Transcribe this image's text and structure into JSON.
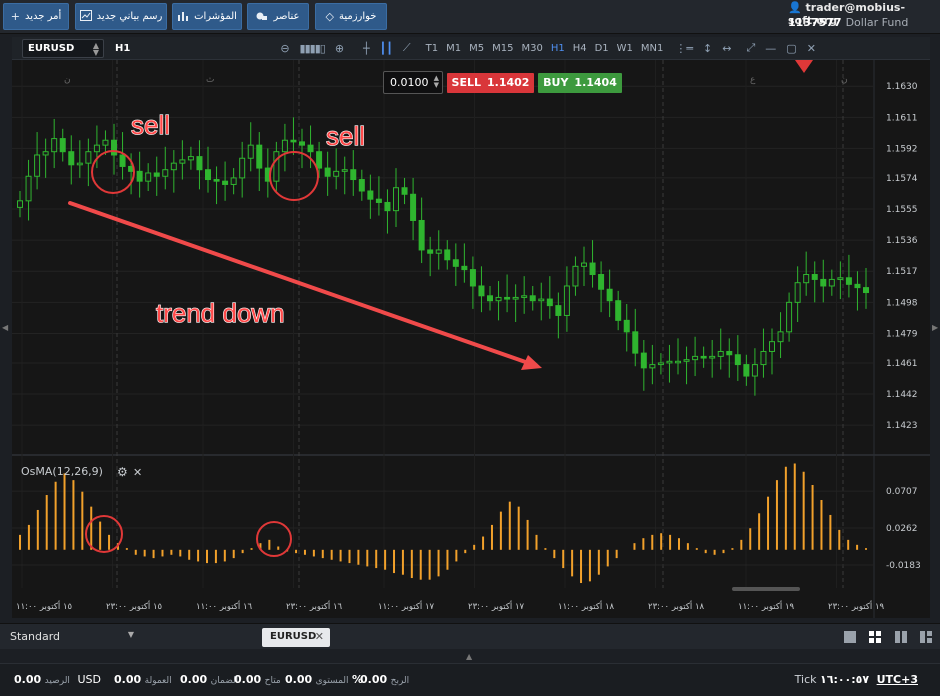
{
  "topbar": {
    "buttons": [
      {
        "label": "أمر جديد",
        "icon": "+"
      },
      {
        "label": "رسم بياني جديد",
        "icon": "chart-icon"
      },
      {
        "label": "المؤشرات",
        "icon": "bars-icon"
      },
      {
        "label": "عناصر",
        "icon": "shapes-icon"
      },
      {
        "label": "خوارزمية",
        "icon": "diamond-icon"
      }
    ],
    "account": {
      "user": "trader@mobius-soft.org",
      "number": "1137577",
      "fund": "Dollar Fund"
    }
  },
  "chart_toolbar": {
    "symbol": "EURUSD",
    "timeframe": "H1",
    "timeframes": [
      "T1",
      "M1",
      "M5",
      "M15",
      "M30",
      "H1",
      "H4",
      "D1",
      "W1",
      "MN1"
    ],
    "active_timeframe": "H1"
  },
  "ticket": {
    "quantity": "0.0100",
    "sell_label": "SELL",
    "sell_price": "1.1402",
    "buy_label": "BUY",
    "buy_price": "1.1404"
  },
  "annotations": {
    "sell1": "sell",
    "sell2": "sell",
    "trend": "trend down"
  },
  "chart_data": [
    {
      "type": "candlestick",
      "symbol": "EURUSD",
      "timeframe": "H1",
      "y_ticks": [
        "1.1630",
        "1.1611",
        "1.1592",
        "1.1574",
        "1.1555",
        "1.1536",
        "1.1517",
        "1.1498",
        "1.1479",
        "1.1461",
        "1.1442",
        "1.1423"
      ],
      "ylim": [
        1.1406,
        1.1646
      ],
      "x_ticks": [
        "١٥ أكتوبر ١١:٠٠",
        "١٥ أكتوبر ٢٣:٠٠",
        "١٦ أكتوبر ١١:٠٠",
        "١٦ أكتوبر ٢٣:٠٠",
        "١٧ أكتوبر ١١:٠٠",
        "١٧ أكتوبر ٢٣:٠٠",
        "١٨ أكتوبر ١١:٠٠",
        "١٨ أكتوبر ٢٣:٠٠",
        "١٩ أكتوبر ١١:٠٠",
        "١٩ أكتوبر ٢٣:٠٠"
      ],
      "day_labels": [
        "ن",
        "ث",
        "ع",
        "ن"
      ],
      "closes": [
        1.156,
        1.1575,
        1.1588,
        1.159,
        1.1598,
        1.159,
        1.1582,
        1.1583,
        1.159,
        1.1594,
        1.1597,
        1.1588,
        1.1581,
        1.1578,
        1.1572,
        1.1577,
        1.1575,
        1.1579,
        1.1583,
        1.1585,
        1.1587,
        1.1579,
        1.1573,
        1.1572,
        1.157,
        1.1574,
        1.1586,
        1.1594,
        1.158,
        1.1572,
        1.159,
        1.1597,
        1.1596,
        1.1594,
        1.159,
        1.158,
        1.1575,
        1.1578,
        1.1579,
        1.1573,
        1.1566,
        1.1561,
        1.1559,
        1.1554,
        1.1568,
        1.1564,
        1.1548,
        1.153,
        1.1528,
        1.153,
        1.1524,
        1.152,
        1.1518,
        1.1508,
        1.1502,
        1.1499,
        1.1501,
        1.15,
        1.1501,
        1.1502,
        1.1499,
        1.15,
        1.1496,
        1.149,
        1.1508,
        1.152,
        1.1522,
        1.1515,
        1.1506,
        1.1499,
        1.1487,
        1.148,
        1.1467,
        1.1458,
        1.146,
        1.1461,
        1.1462,
        1.1462,
        1.1463,
        1.1465,
        1.1464,
        1.1465,
        1.1468,
        1.1466,
        1.146,
        1.1453,
        1.146,
        1.1468,
        1.1474,
        1.148,
        1.1498,
        1.151,
        1.1515,
        1.1512,
        1.1508,
        1.1512,
        1.1513,
        1.1509,
        1.1507,
        1.1504
      ],
      "series": [
        {
          "name": "OsMA(12,26,9)"
        }
      ],
      "osma_ticks": [
        "0.0707",
        "0.0262",
        "-0.0183"
      ],
      "osma_ylim": [
        -0.046,
        0.113
      ],
      "osma_values": [
        0.018,
        0.03,
        0.048,
        0.066,
        0.082,
        0.092,
        0.084,
        0.07,
        0.052,
        0.034,
        0.018,
        0.008,
        0.002,
        -0.006,
        -0.008,
        -0.01,
        -0.008,
        -0.006,
        -0.008,
        -0.012,
        -0.014,
        -0.016,
        -0.016,
        -0.014,
        -0.01,
        -0.004,
        0.002,
        0.008,
        0.012,
        0.004,
        -0.002,
        -0.004,
        -0.006,
        -0.008,
        -0.01,
        -0.012,
        -0.014,
        -0.016,
        -0.018,
        -0.02,
        -0.022,
        -0.024,
        -0.028,
        -0.03,
        -0.034,
        -0.036,
        -0.036,
        -0.032,
        -0.024,
        -0.014,
        -0.004,
        0.006,
        0.016,
        0.03,
        0.046,
        0.058,
        0.052,
        0.036,
        0.018,
        0.002,
        -0.01,
        -0.022,
        -0.032,
        -0.04,
        -0.038,
        -0.03,
        -0.02,
        -0.01,
        0.0,
        0.008,
        0.014,
        0.018,
        0.02,
        0.018,
        0.014,
        0.008,
        0.002,
        -0.004,
        -0.006,
        -0.004,
        0.002,
        0.012,
        0.026,
        0.044,
        0.064,
        0.084,
        0.1,
        0.104,
        0.094,
        0.078,
        0.06,
        0.042,
        0.024,
        0.012,
        0.006,
        0.002
      ]
    }
  ],
  "indicator": {
    "label": "OsMA(12,26,9)"
  },
  "tabbar": {
    "layout": "Standard",
    "symbol_tab": "EURUSD"
  },
  "status": {
    "balance_label": "الرصيد",
    "balance_currency": "USD",
    "balance": "0.00",
    "commission_label": "العمولة",
    "commission": "0.00",
    "margin_label": "الضمان",
    "margin": "0.00",
    "available_label": "متاح",
    "available": "0.00",
    "level_label": "المستوى",
    "level": "%",
    "profit_label": "الربح",
    "profit": "0.00",
    "tick_label": "Tick",
    "time": "١٦:٠٠:٥٧",
    "tz": "UTC+3"
  }
}
